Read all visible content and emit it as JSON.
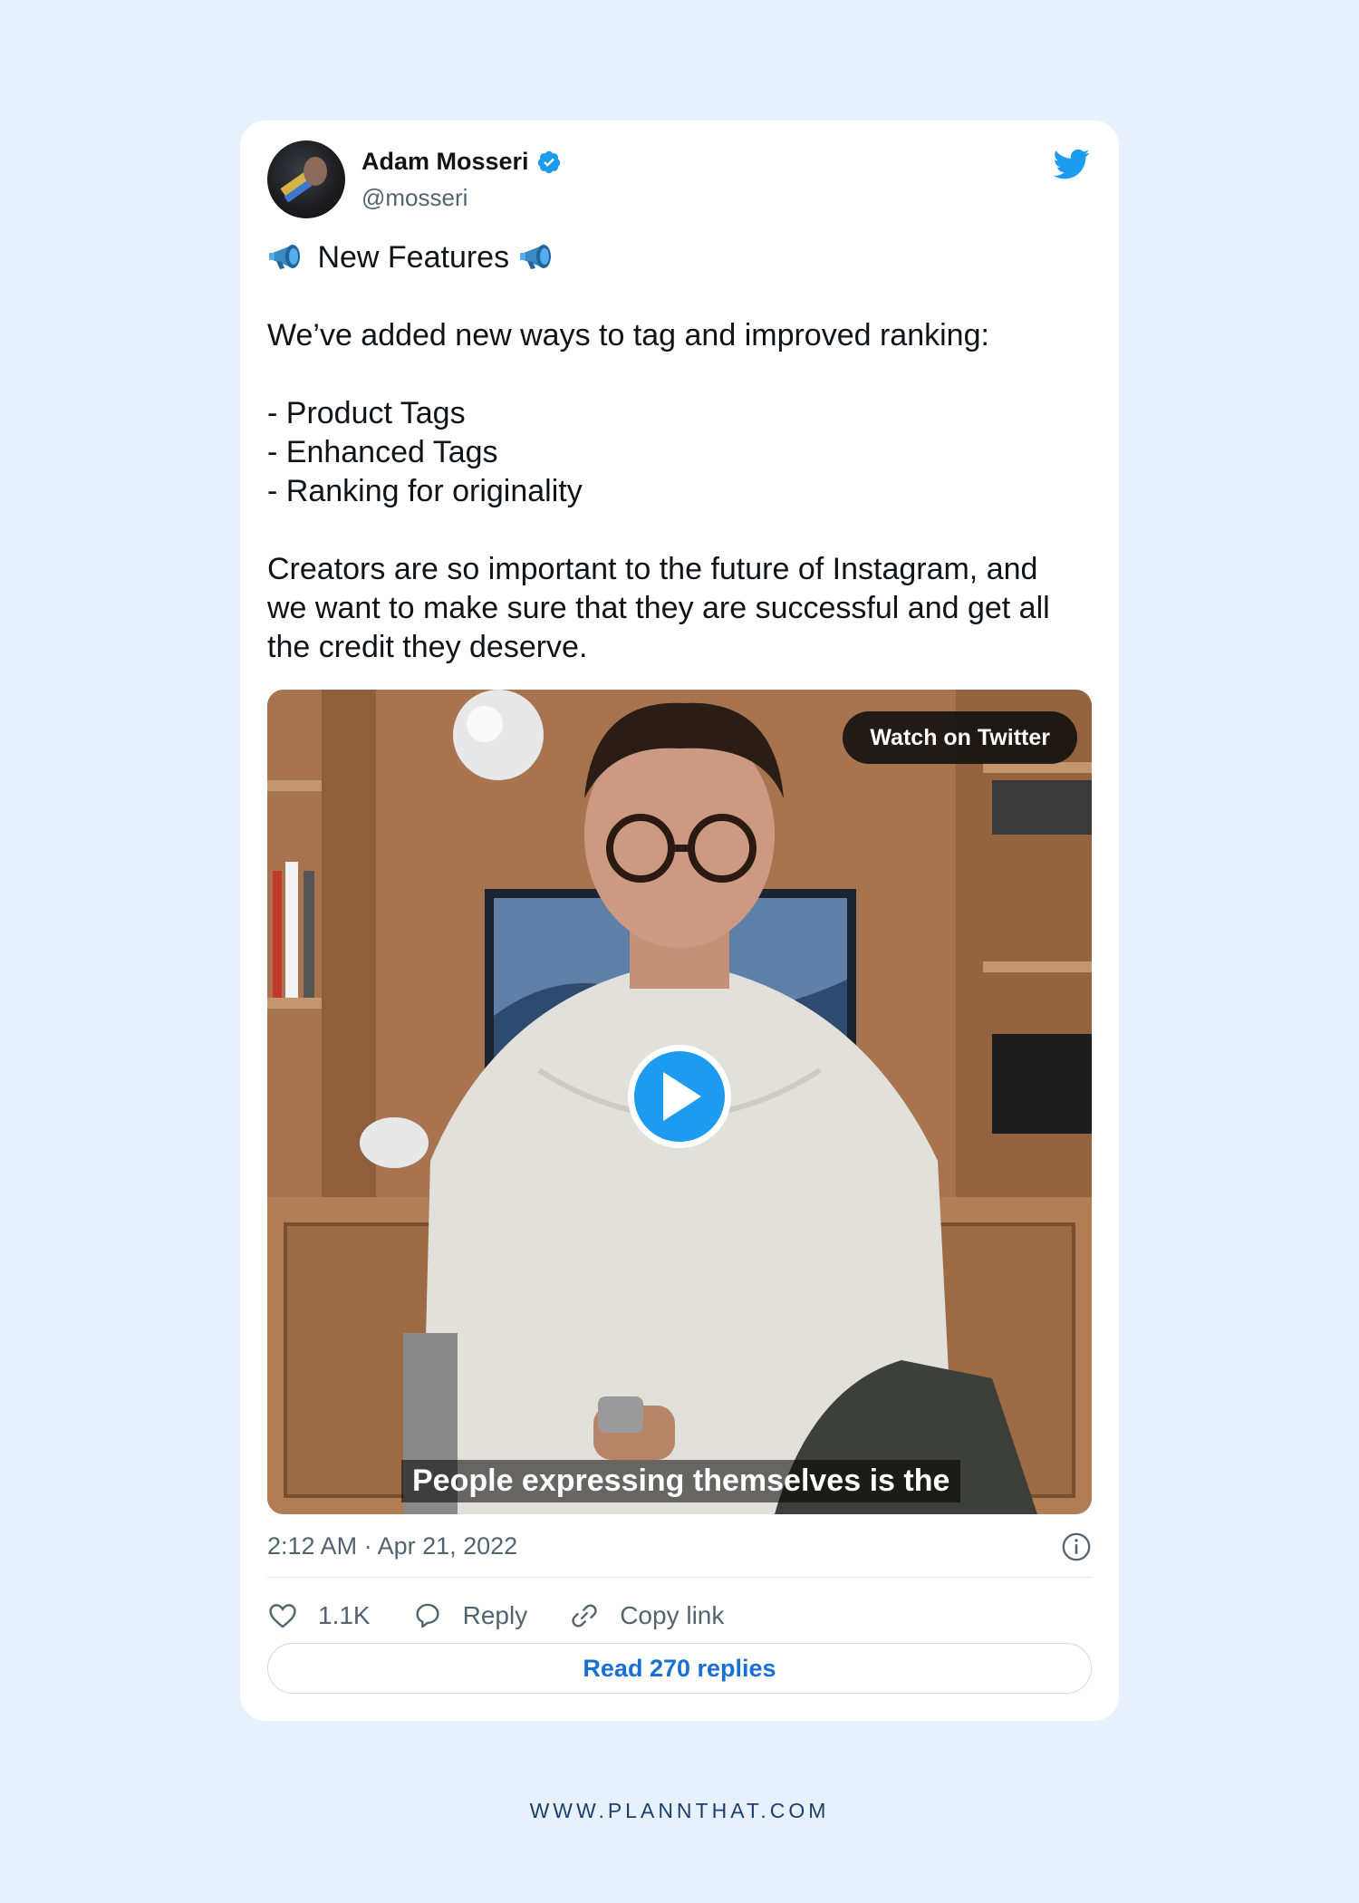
{
  "author": {
    "name": "Adam Mosseri",
    "handle": "@mosseri",
    "verified": true
  },
  "tweet": {
    "title_line": "New Features",
    "line1": "We’ve added new ways to tag and improved ranking:",
    "bullets": [
      "- Product Tags",
      "- Enhanced Tags",
      "- Ranking for originality"
    ],
    "paragraph": "Creators are so important to the future of Instagram, and we want to make sure that they are successful and get all the credit they deserve."
  },
  "media": {
    "watch_label": "Watch on Twitter",
    "caption": "People expressing themselves is the"
  },
  "meta": {
    "timestamp": "2:12 AM · Apr 21, 2022"
  },
  "actions": {
    "likes": "1.1K",
    "reply_label": "Reply",
    "copy_label": "Copy link"
  },
  "replies_button": "Read 270 replies",
  "footer": "WWW.PLANNTHAT.COM",
  "colors": {
    "background": "#e6f1fd",
    "twitter_blue": "#1d9bf0",
    "link_blue": "#1a6fd6"
  },
  "icons": [
    "verified-badge-icon",
    "twitter-bird-icon",
    "megaphone-icon",
    "play-icon",
    "info-icon",
    "heart-icon",
    "reply-bubble-icon",
    "link-icon"
  ]
}
